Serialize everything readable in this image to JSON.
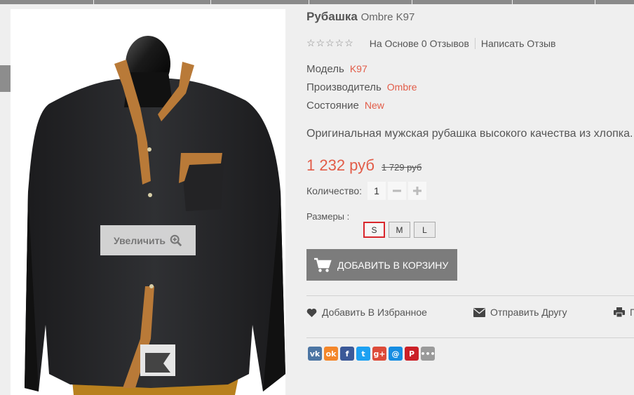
{
  "product": {
    "title_bold": "Рубашка",
    "title_rest": "Ombre K97",
    "rating": {
      "stars": "☆☆☆☆☆",
      "reviews_link": "На Основе 0 Отзывов",
      "write_review": "Написать Отзыв"
    },
    "specs": {
      "model_label": "Модель",
      "model_value": "K97",
      "maker_label": "Производитель",
      "maker_value": "Ombre",
      "condition_label": "Состояние",
      "condition_value": "New"
    },
    "description": "Оригинальная мужская рубашка высокого качества из хлопка.",
    "price_new": "1 232 руб",
    "price_old": "1 729 руб",
    "quantity_label": "Количество:",
    "quantity_value": "1",
    "sizes_label": "Размеры :",
    "sizes": [
      "S",
      "M",
      "L"
    ],
    "selected_size": "S",
    "add_to_cart": "ДОБАВИТЬ В КОРЗИНУ"
  },
  "image": {
    "zoom_label": "Увеличить"
  },
  "actions": {
    "wishlist": "Добавить В Избранное",
    "send_friend": "Отправить Другу",
    "print": "П"
  },
  "social": [
    {
      "name": "vk",
      "glyph": "vk",
      "color": "#4c75a3"
    },
    {
      "name": "odnoklassniki",
      "glyph": "ok",
      "color": "#f4872a"
    },
    {
      "name": "facebook",
      "glyph": "f",
      "color": "#3b5998"
    },
    {
      "name": "twitter",
      "glyph": "t",
      "color": "#1da1f2"
    },
    {
      "name": "google-plus",
      "glyph": "g+",
      "color": "#dd4b39"
    },
    {
      "name": "mail",
      "glyph": "@",
      "color": "#168de2"
    },
    {
      "name": "pinterest",
      "glyph": "P",
      "color": "#cb2027"
    },
    {
      "name": "more",
      "glyph": "•••",
      "color": "#9a9a9a"
    }
  ],
  "colors": {
    "accent": "#e25c48",
    "button": "#7c7c7c",
    "selected_border": "#d9262c"
  }
}
